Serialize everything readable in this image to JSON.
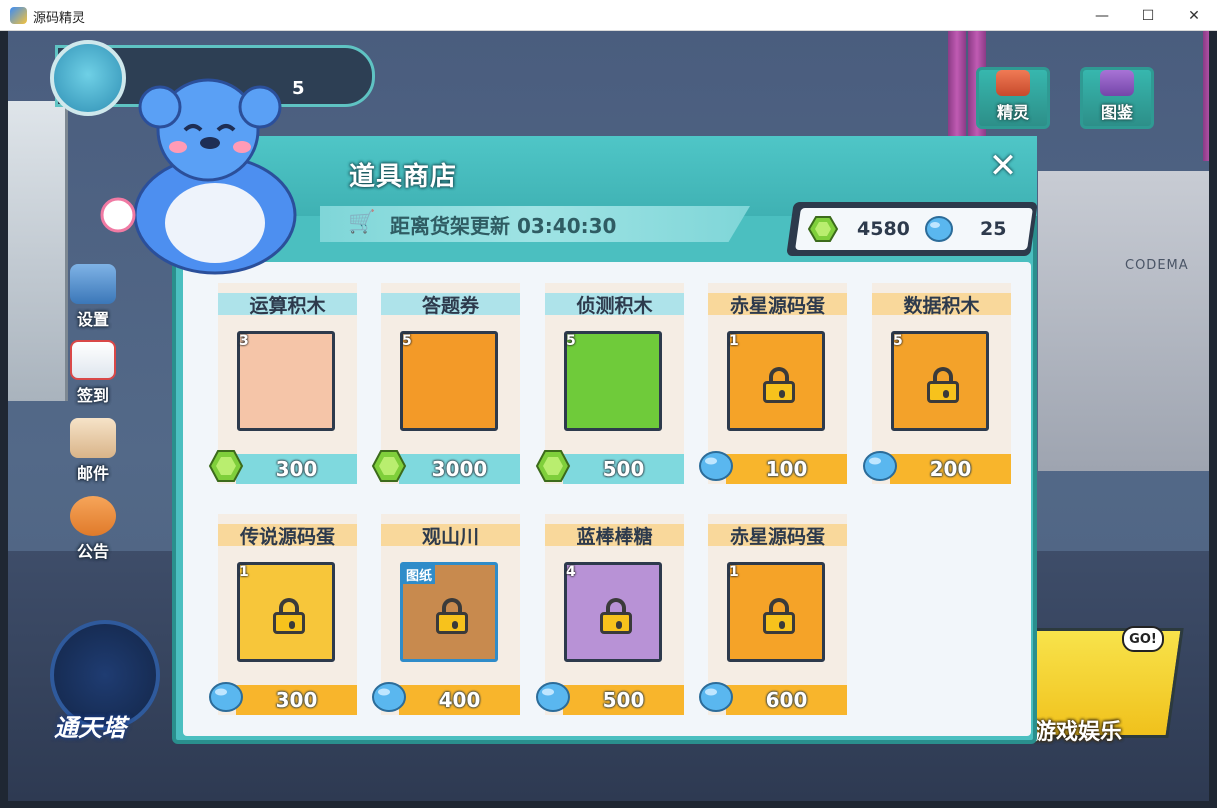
{
  "window": {
    "title": "源码精灵",
    "minimize": "—",
    "maximize": "☐",
    "close": "✕"
  },
  "scene": {
    "brand_text": "CODEMA",
    "profile_number": "5"
  },
  "sidebar": {
    "items": [
      {
        "label": "设置",
        "icon": "gear-icon"
      },
      {
        "label": "签到",
        "icon": "calendar-icon"
      },
      {
        "label": "邮件",
        "icon": "mail-icon"
      },
      {
        "label": "公告",
        "icon": "megaphone-icon"
      }
    ]
  },
  "top_buttons": [
    {
      "label": "精灵",
      "icon": "spirit-icon"
    },
    {
      "label": "图鉴",
      "icon": "book-icon"
    }
  ],
  "tower": {
    "label": "通天塔"
  },
  "entertainment": {
    "label": "游戏娱乐",
    "go": "GO!"
  },
  "shop": {
    "title": "道具商店",
    "close": "✕",
    "refresh_text": "距离货架更新 03:40:30",
    "currency": {
      "gems": "4580",
      "blue_coins": "25"
    },
    "colors": {
      "gem": "#7fcf3b",
      "coin": "#5ab7ef",
      "cyan_bar": "#7fd9de",
      "orange_bar": "#f8b52c"
    },
    "items": [
      {
        "name": "运算积木",
        "qty": "3",
        "price": "300",
        "currency": "gem",
        "card_color": "#f5c5a8"
      },
      {
        "name": "答题券",
        "qty": "5",
        "price": "3000",
        "currency": "gem",
        "card_color": "#f39a28"
      },
      {
        "name": "侦测积木",
        "qty": "5",
        "price": "500",
        "currency": "gem",
        "card_color": "#6fcb3a"
      },
      {
        "name": "赤星源码蛋",
        "qty": "1",
        "price": "100",
        "currency": "coin",
        "card_color": "#f5a328"
      },
      {
        "name": "数据积木",
        "qty": "5",
        "price": "200",
        "currency": "coin",
        "card_color": "#f3a22a"
      },
      {
        "name": "传说源码蛋",
        "qty": "1",
        "price": "300",
        "currency": "coin",
        "card_color": "#f7c63a"
      },
      {
        "name": "观山川",
        "tag": "图纸",
        "price": "400",
        "currency": "coin",
        "card_color": "#c88a4e"
      },
      {
        "name": "蓝棒棒糖",
        "qty": "4",
        "price": "500",
        "currency": "coin",
        "card_color": "#b892d6"
      },
      {
        "name": "赤星源码蛋",
        "qty": "1",
        "price": "600",
        "currency": "coin",
        "card_color": "#f5a328"
      }
    ]
  }
}
